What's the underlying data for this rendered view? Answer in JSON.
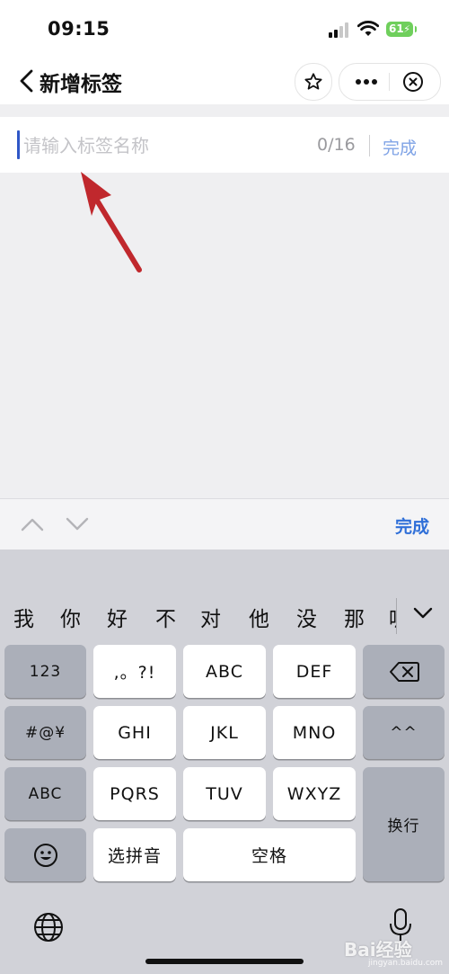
{
  "status_bar": {
    "time": "09:15",
    "battery_level": "61"
  },
  "nav": {
    "title": "新增标签"
  },
  "input": {
    "placeholder": "请输入标签名称",
    "value": "",
    "counter": "0/16",
    "done_label": "完成"
  },
  "accessory": {
    "done_label": "完成"
  },
  "keyboard": {
    "candidates": [
      "我",
      "你",
      "好",
      "不",
      "对",
      "他",
      "没",
      "那",
      "呢"
    ],
    "keys": {
      "num_123": "123",
      "punct": ",。?!",
      "abc1": "ABC",
      "def": "DEF",
      "symbols": "#@¥",
      "ghi": "GHI",
      "jkl": "JKL",
      "mno": "MNO",
      "emoticon": "^^",
      "abc_switch": "ABC",
      "pqrs": "PQRS",
      "tuv": "TUV",
      "wxyz": "WXYZ",
      "newline": "换行",
      "pinyin": "选拼音",
      "space": "空格"
    }
  },
  "watermark": {
    "brand": "Bai经验",
    "url": "jingyan.baidu.com"
  },
  "colors": {
    "accent": "#2f6fd8",
    "annotation_arrow": "#c0282d",
    "battery": "#6fcf5c"
  }
}
